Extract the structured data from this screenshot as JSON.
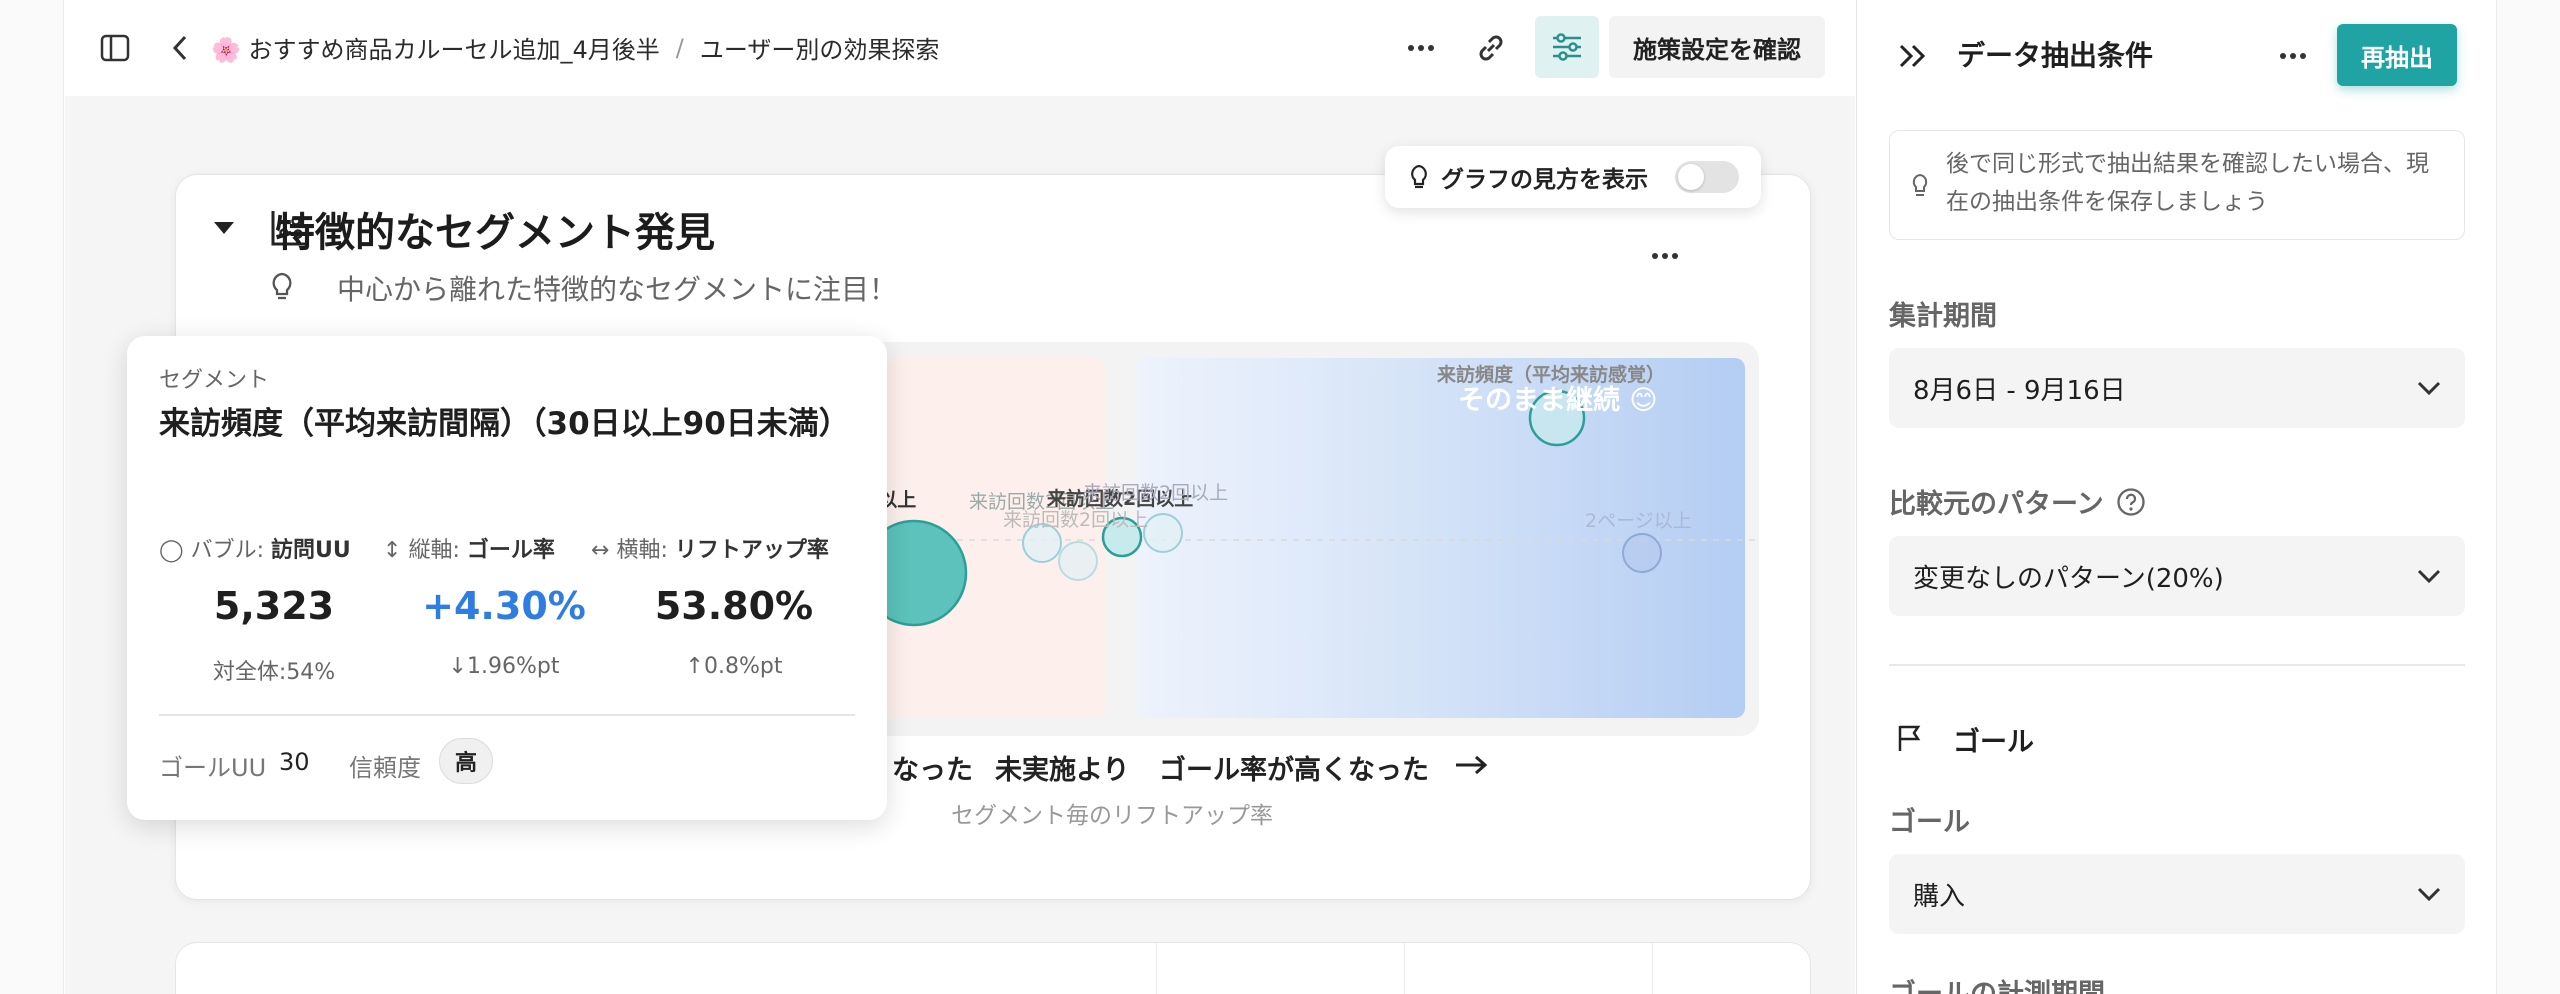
{
  "breadcrumb": {
    "project": "🌸 おすすめ商品カルーセル追加_4月後半",
    "separator": "/",
    "page": "ユーザー別の効果探索"
  },
  "toolbar": {
    "confirm_label": "施策設定を確認"
  },
  "card": {
    "title": "特徴的なセグメント発見",
    "subtitle": "中心から離れた特徴的なセグメントに注目！",
    "graph_toggle_label": "グラフの見方を表示",
    "graph_toggle_on": false
  },
  "chart": {
    "point_labels": {
      "a": "回数2回以上",
      "b": "来訪回数2回以上",
      "c": "来訪回数2回以上",
      "d": "来訪回数2回以上",
      "e": "来訪回数2回以上",
      "f": "来訪頻度（平均来訪感覚）",
      "g": "2ページ以上"
    },
    "quadrant_label": "そのまま継続 😊",
    "x_axis_left": "が低くなった",
    "x_axis_mid": "未実施より",
    "x_axis_right": "ゴール率が高くなった",
    "x_axis_sub": "セグメント毎のリフトアップ率"
  },
  "tooltip": {
    "caption": "セグメント",
    "title": "来訪頻度（平均来訪間隔）（30日以上90日未満）",
    "bubble_label": "バブル:",
    "bubble_value": "訪問UU",
    "vert_label": "縦軸:",
    "vert_value": "ゴール率",
    "horiz_label": "横軸:",
    "horiz_value": "リフトアップ率",
    "stats": [
      {
        "value": "5,323",
        "delta": "対全体:54%"
      },
      {
        "value": "+4.30%",
        "delta": "↓1.96%pt"
      },
      {
        "value": "53.80%",
        "delta": "↑0.8%pt"
      }
    ],
    "goal_uu_label": "ゴールUU",
    "goal_uu_value": "30",
    "confidence_label": "信頼度",
    "confidence_value": "高"
  },
  "panel": {
    "title": "データ抽出条件",
    "rerun_label": "再抽出",
    "hint": "後で同じ形式で抽出結果を確認したい場合、現在の抽出条件を保存しましょう",
    "period_label": "集計期間",
    "period_value": "8月6日 - 9月16日",
    "compare_label": "比較元のパターン",
    "compare_value": "変更なしのパターン(20%)",
    "goal_section": "ゴール",
    "goal_label": "ゴール",
    "goal_value": "購入",
    "goal_period_label": "ゴールの計測期間"
  },
  "colors": {
    "accent": "#1fa3a3",
    "positive_blue": "#2f7de1",
    "bubble_teal": "#5cc2bb"
  }
}
